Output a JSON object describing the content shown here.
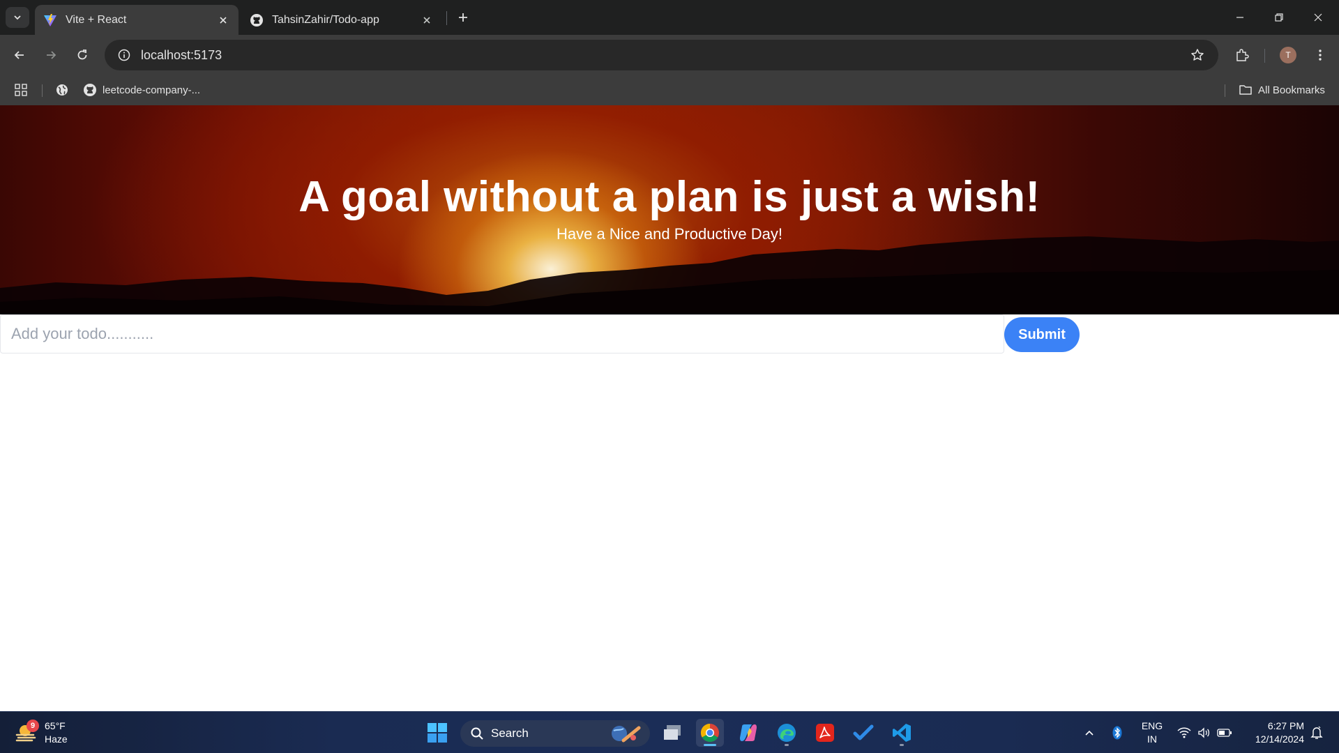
{
  "browser": {
    "tabs": [
      {
        "title": "Vite + React",
        "active": true,
        "icon": "vite-logo-icon"
      },
      {
        "title": "TahsinZahir/Todo-app",
        "active": false,
        "icon": "github-icon"
      }
    ],
    "url": "localhost:5173",
    "profile_initial": "T",
    "bookmarks": [
      {
        "label": "leetcode-company-...",
        "icon": "github-icon"
      }
    ],
    "all_bookmarks_label": "All Bookmarks"
  },
  "page": {
    "title": "A goal without a plan is just a wish!",
    "subtitle": "Have a Nice and Productive Day!",
    "todo_input": {
      "placeholder": "Add your todo...........",
      "value": ""
    },
    "submit_label": "Submit",
    "colors": {
      "submit_button": "#3b82f6",
      "hero_sun": "#f4c44c",
      "hero_sky": "#8a1f04"
    }
  },
  "taskbar": {
    "weather": {
      "temp": "65°F",
      "condition": "Haze",
      "badge": "9"
    },
    "search_label": "Search",
    "language": {
      "line1": "ENG",
      "line2": "IN"
    },
    "time": "6:27 PM",
    "date": "12/14/2024",
    "pinned": [
      "task-view-icon",
      "chrome-icon",
      "copilot-icon",
      "edge-icon",
      "acrobat-icon",
      "todo-check-icon",
      "vscode-icon"
    ]
  }
}
